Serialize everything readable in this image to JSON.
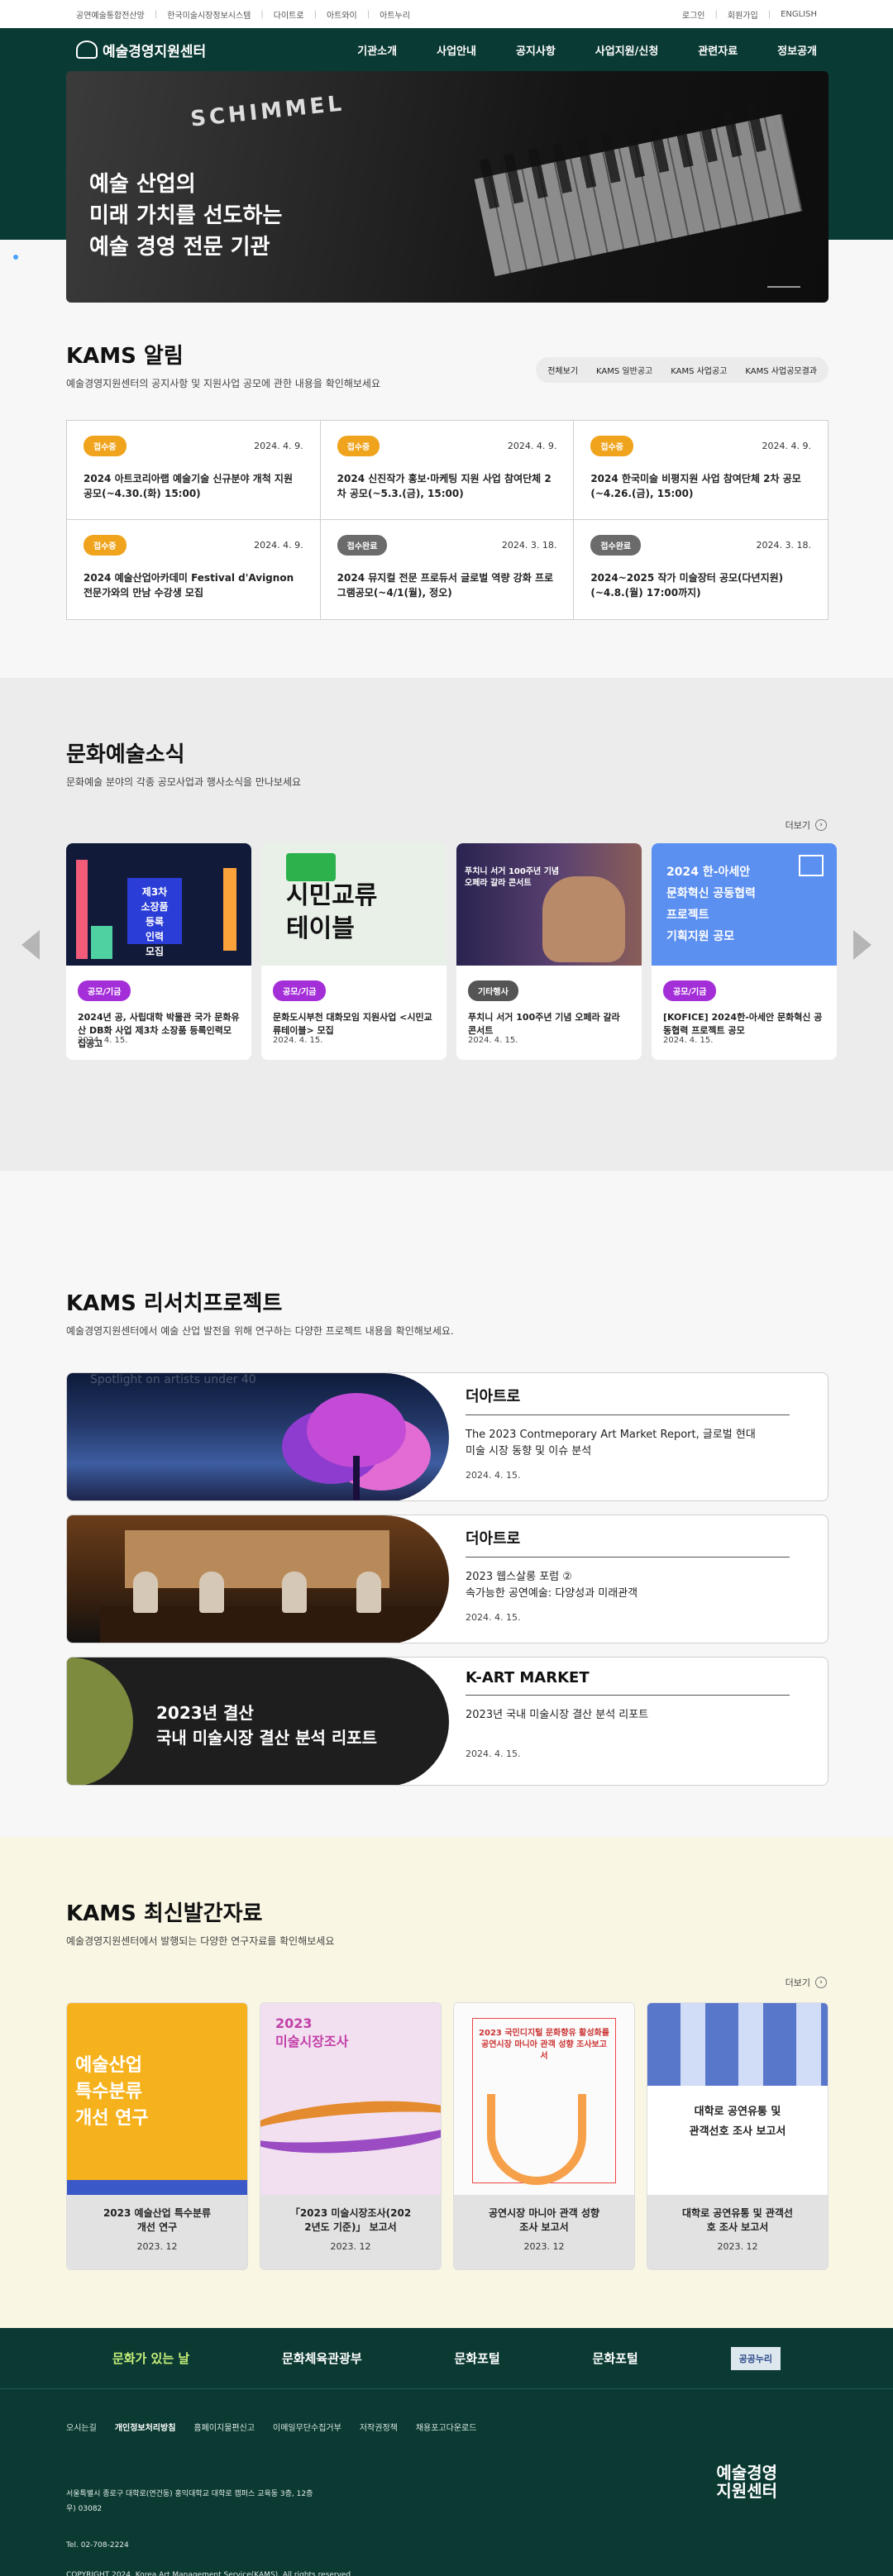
{
  "topbar": {
    "links": [
      "공연예술통합전산망",
      "한국미술시장정보시스템",
      "다이트로",
      "아트와이",
      "아트누리"
    ],
    "right": [
      "로그인",
      "회원가입",
      "ENGLISH"
    ]
  },
  "header": {
    "logo": "예술경영지원센터",
    "menu": [
      "기관소개",
      "사업안내",
      "공지사항",
      "사업지원/신청",
      "관련자료",
      "정보공개"
    ]
  },
  "hero": {
    "brand": "SCHIMMEL",
    "title": "예술 산업의\n미래 가치를 선도하는\n예술 경영 전문 기관"
  },
  "notice": {
    "title": "KAMS 알림",
    "desc": "예술경영지원센터의 공지사항 및 지원사업 공모에 관한 내용을 확인해보세요",
    "tabs": [
      "전체보기",
      "KAMS 일반공고",
      "KAMS 사업공고",
      "KAMS 사업공모결과"
    ],
    "items": [
      {
        "status": "접수중",
        "type": "open",
        "date": "2024. 4. 9.",
        "title": "2024 아트코리아랩 예술기술 신규분야 개척 지원 공모(~4.30.(화) 15:00)"
      },
      {
        "status": "접수중",
        "type": "open",
        "date": "2024. 4. 9.",
        "title": "2024 신진작가 홍보·마케팅 지원 사업 참여단체 2차 공모(~5.3.(금), 15:00)"
      },
      {
        "status": "접수중",
        "type": "open",
        "date": "2024. 4. 9.",
        "title": "2024 한국미술 비평지원 사업 참여단체 2차 공모(~4.26.(금), 15:00)"
      },
      {
        "status": "접수중",
        "type": "open",
        "date": "2024. 4. 9.",
        "title": "2024 예술산업아카데미 Festival d'Avignon 전문가와의 만남 수강생 모집"
      },
      {
        "status": "접수완료",
        "type": "done",
        "date": "2024. 3. 18.",
        "title": "2024 뮤지컬 전문 프로듀서 글로벌 역량 강화 프로그램공모(~4/1(월), 정오)"
      },
      {
        "status": "접수완료",
        "type": "done",
        "date": "2024. 3. 18.",
        "title": "2024~2025 작가 미술장터 공모(다년지원)(~4.8.(월) 17:00까지)"
      }
    ]
  },
  "culture": {
    "title": "문화예술소식",
    "desc": "문화예술 분야의 각종 공모사업과 행사소식을 만나보세요",
    "more": "더보기",
    "cards": [
      {
        "badge": "공모/기금",
        "title": "2024년 공, 사립대학 박물관 국가 문화유산 DB화 사업 제3차 소장품 등록인력모집공고",
        "date": "2024. 4. 15.",
        "thumb_text": "제3차\n소장품\n등록\n인력\n모집"
      },
      {
        "badge": "공모/기금",
        "title": "문화도시부천 대화모임 지원사업 <시민교류테이블> 모집",
        "date": "2024. 4. 15.",
        "thumb_text": "시민교류\n테이블"
      },
      {
        "badge": "기타행사",
        "title": "푸치니 서거 100주년 기념 오페라 갈라 콘서트",
        "date": "2024. 4. 15.",
        "thumb_text": "푸치니 서거 100주년 기념\n오페라 갈라 콘서트"
      },
      {
        "badge": "공모/기금",
        "title": "[KOFICE] 2024한-아세안 문화혁신 공동협력 프로젝트 공모",
        "date": "2024. 4. 15.",
        "thumb_text": "2024 한-아세안\n문화혁신 공동협력\n프로젝트\n기획지원 공모"
      }
    ]
  },
  "research": {
    "title": "KAMS 리서치프로젝트",
    "desc": "예술경영지원센터에서 예술 산업 발전을 위해 연구하는 다양한 프로젝트 내용을 확인해보세요.",
    "items": [
      {
        "category": "더아트로",
        "desc": "The 2023 Contmeporary Art Market Report, 글로벌 현대\n미술 시장 동향 및 이슈 분석",
        "date": "2024. 4. 15.",
        "ghost": "Spotlight on artists under 40"
      },
      {
        "category": "더아트로",
        "desc": "2023 웹스살롱 포럼 ②\n속가능한 공연예술: 다양성과 미래관객",
        "date": "2024. 4. 15."
      },
      {
        "category": "K-ART MARKET",
        "desc": "2023년 국내 미술시장 결산 분석 리포트",
        "date": "2024. 4. 15.",
        "image_text": "2023년 결산\n국내 미술시장 결산 분석 리포트"
      }
    ]
  },
  "pubs": {
    "title": "KAMS 최신발간자료",
    "desc": "예술경영지원센터에서 발행되는 다양한 연구자료를 확인해보세요",
    "more": "더보기",
    "books": [
      {
        "title": "2023 예술산업 특수분류\n개선 연구",
        "date": "2023. 12",
        "cover": "예술산업\n특수분류\n개선 연구"
      },
      {
        "title": "「2023 미술시장조사(202\n2년도 기준)」 보고서",
        "date": "2023. 12",
        "cover": "2023\n미술시장조사"
      },
      {
        "title": "공연시장 마니아 관객 성향\n조사 보고서",
        "date": "2023. 12",
        "cover": "2023 국민디지털 문화향유 활성화를\n공연시장 마니아 관객 성향 조사보고서"
      },
      {
        "title": "대학로 공연유통 및 관객선\n호 조사 보고서",
        "date": "2023. 12",
        "cover": "대학로 공연유통 및\n관객선호 조사 보고서"
      }
    ]
  },
  "footer": {
    "partners": [
      "문화가 있는 날",
      "문화체육관광부",
      "문화포털",
      "문화포털",
      "공공누리"
    ],
    "links": [
      "오시는길",
      "개인정보처리방침",
      "홈페이지물편신고",
      "이메일무단수집거부",
      "저작권정책",
      "채용포고다운로드"
    ],
    "address": "서울특별시 종로구 대학로(연건동) 홍익대학교 대학로 캠퍼스 교육동 3층, 12층\n우) 03082",
    "tel": "Tel. 02-708-2224",
    "copyright": "COPYRIGHT 2024. Korea Art Management Service(KAMS). All rights reserved",
    "logo": "예술경영\n지원센터"
  },
  "colors": {
    "brand": "#0b3a33",
    "open": "#f0a31c",
    "done": "#6b6b6b",
    "purple": "#a42fd8"
  }
}
